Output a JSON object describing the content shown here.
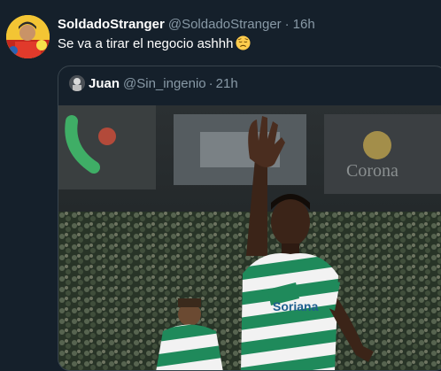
{
  "tweet": {
    "author": {
      "display_name": "SoldadoStranger",
      "handle": "@SoldadoStranger",
      "avatar_icon": "user-avatar"
    },
    "separator": "·",
    "time": "16h",
    "text": "Se va a tirar el negocio ashhh",
    "emoji_icon": "disappointed-face-emoji"
  },
  "quoted_tweet": {
    "author": {
      "display_name": "Juan",
      "handle": "@Sin_ingenio",
      "avatar_icon": "user-avatar"
    },
    "separator": "·",
    "time": "21h",
    "media_icon": "soccer-player-photo"
  },
  "colors": {
    "background": "#15202b",
    "text_primary": "#ffffff",
    "text_secondary": "#8899a6",
    "border": "#38444d",
    "kit_green": "#1f8a5b",
    "kit_white": "#f2f2f2"
  }
}
